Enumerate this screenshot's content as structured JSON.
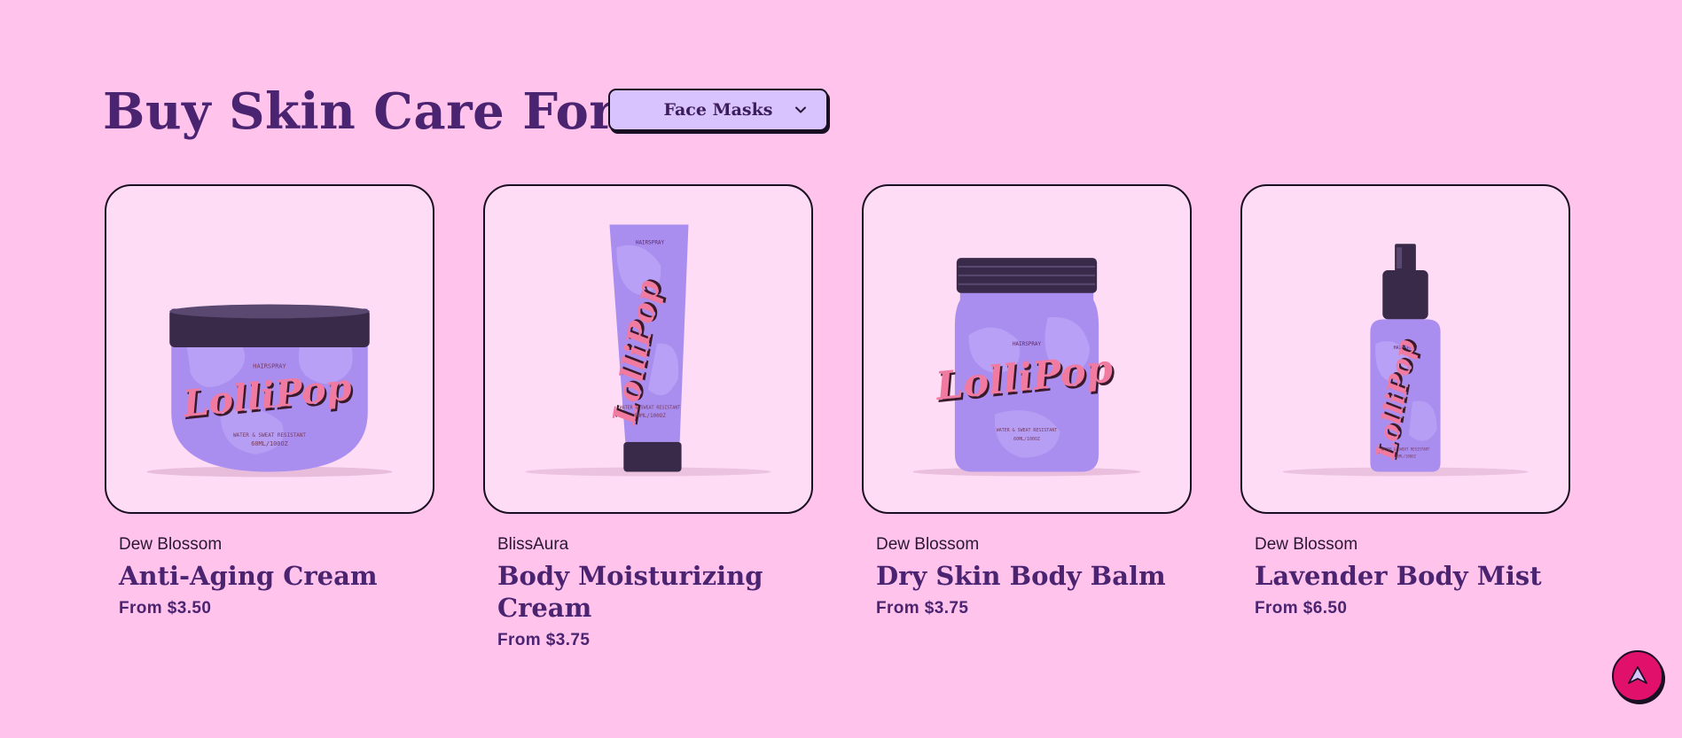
{
  "header": {
    "title": "Buy Skin Care For",
    "category_select": {
      "value": "Face Masks"
    }
  },
  "products": [
    {
      "brand": "Dew Blossom",
      "title": "Anti-Aging Cream",
      "price": "From $3.50"
    },
    {
      "brand": "BlissAura",
      "title": "Body Moisturizing Cream",
      "price": "From $3.75"
    },
    {
      "brand": "Dew Blossom",
      "title": "Dry Skin Body Balm",
      "price": "From $3.75"
    },
    {
      "brand": "Dew Blossom",
      "title": "Lavender Body Mist",
      "price": "From $6.50"
    }
  ],
  "product_label": "LolliPop",
  "icons": {
    "select": "chevron-down-icon",
    "scroll_top": "arrow-up-icon"
  },
  "colors": {
    "background": "#ffc3ec",
    "title": "#4a2470",
    "select_bg": "#d8c3ff",
    "card_bg": "#ffdcf5",
    "packaging": "#a98ef0",
    "accent": "#e0106b"
  }
}
